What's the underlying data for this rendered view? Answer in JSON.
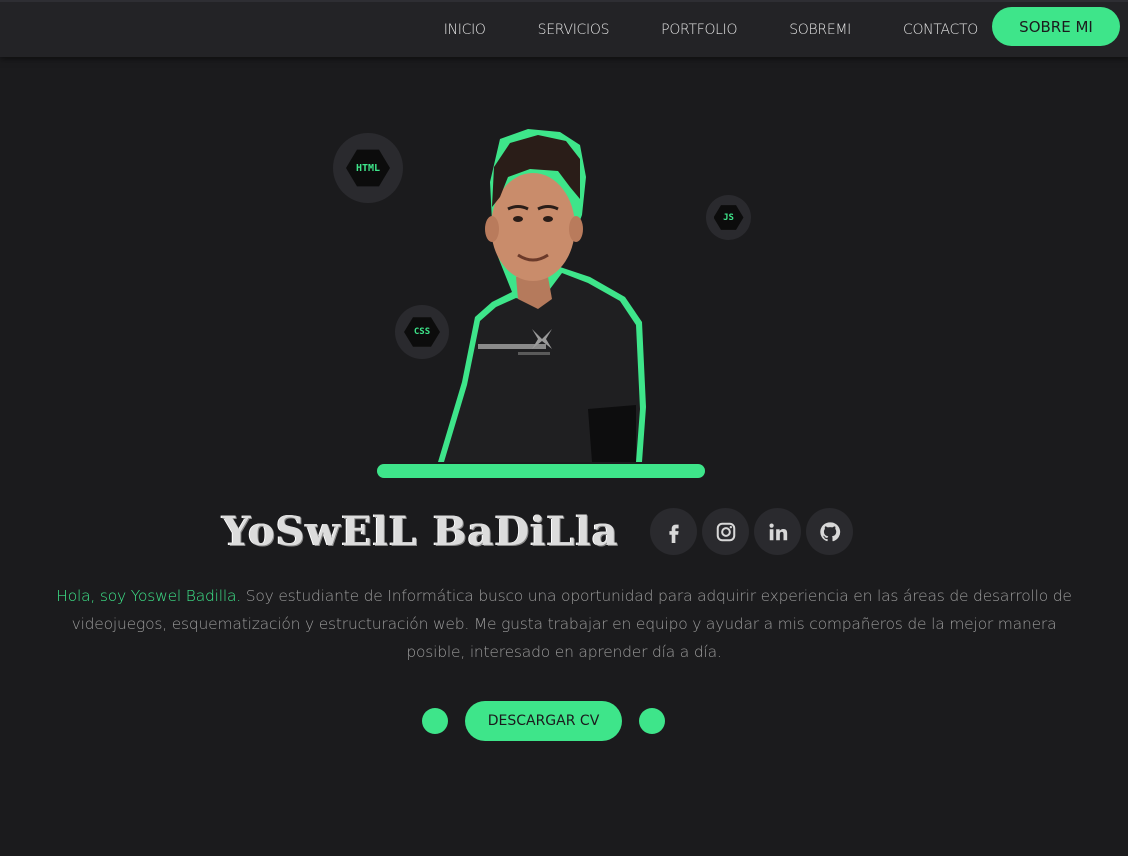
{
  "nav": {
    "links": [
      {
        "label": "INICIO"
      },
      {
        "label": "SERVICIOS"
      },
      {
        "label": "PORTFOLIO"
      },
      {
        "label": "SOBREMI"
      },
      {
        "label": "CONTACTO"
      }
    ],
    "cta_label": "SOBRE MI"
  },
  "hero": {
    "badges": {
      "html": "HTML",
      "css": "CSS",
      "js": "JS"
    },
    "name": "YoSwElL BaDiLla",
    "socials": [
      {
        "icon": "facebook-icon"
      },
      {
        "icon": "instagram-icon"
      },
      {
        "icon": "linkedin-icon"
      },
      {
        "icon": "github-icon"
      }
    ]
  },
  "bio": {
    "highlight": "Hola, soy Yoswel Badilla.",
    "text": " Soy estudiante de Informática busco una oportunidad para adquirir experiencia en las áreas de desarrollo de videojuegos, esquematización y estructuración web. Me gusta trabajar en equipo y ayudar a mis compañeros de la mejor manera posible, interesado en aprender día a día."
  },
  "download_label": "DESCARGAR CV",
  "colors": {
    "accent": "#3ee58a",
    "background": "#1b1b1d",
    "nav": "#232326"
  }
}
